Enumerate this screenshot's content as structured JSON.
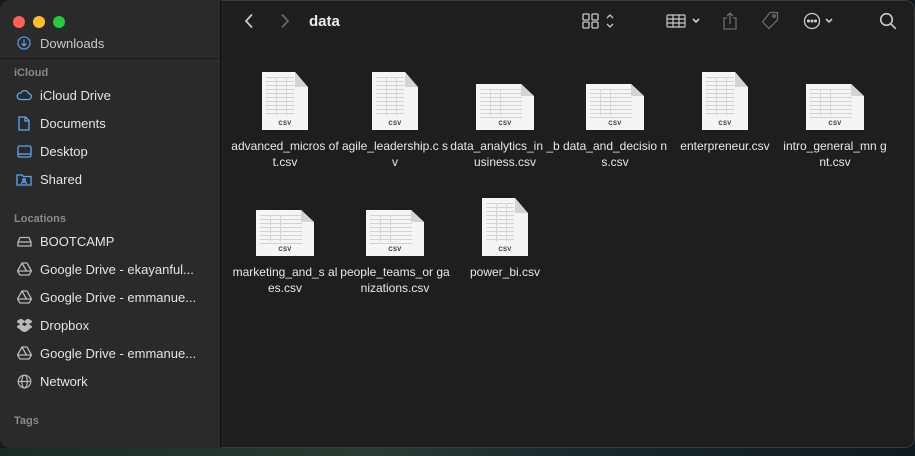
{
  "window": {
    "title": "data"
  },
  "sidebar": {
    "partial_item": "Downloads",
    "sections": [
      {
        "heading": "iCloud",
        "items": [
          {
            "label": "iCloud Drive",
            "icon": "cloud-icon"
          },
          {
            "label": "Documents",
            "icon": "document-icon"
          },
          {
            "label": "Desktop",
            "icon": "desktop-icon"
          },
          {
            "label": "Shared",
            "icon": "shared-folder-icon"
          }
        ]
      },
      {
        "heading": "Locations",
        "items": [
          {
            "label": "BOOTCAMP",
            "icon": "drive-icon"
          },
          {
            "label": "Google Drive - ekayanful...",
            "icon": "google-drive-icon"
          },
          {
            "label": "Google Drive - emmanue...",
            "icon": "google-drive-icon"
          },
          {
            "label": "Dropbox",
            "icon": "dropbox-icon"
          },
          {
            "label": "Google Drive - emmanue...",
            "icon": "google-drive-icon"
          },
          {
            "label": "Network",
            "icon": "globe-icon"
          }
        ]
      },
      {
        "heading": "Tags",
        "items": []
      }
    ]
  },
  "toolbar": {
    "back_icon": "chevron-left-icon",
    "forward_icon": "chevron-right-icon",
    "view_icon": "grid-view-icon",
    "group_icon": "group-icon",
    "share_icon": "share-icon",
    "tag_icon": "tag-icon",
    "more_icon": "ellipsis-icon",
    "search_icon": "search-icon"
  },
  "files": [
    {
      "name": "advanced_microsoft.csv",
      "display": "advanced_micros oft.csv",
      "shape": "tall",
      "badge": "CSV"
    },
    {
      "name": "agile_leadership.csv",
      "display": "agile_leadership.c sv",
      "shape": "tall",
      "badge": "CSV"
    },
    {
      "name": "data_analytics_in_business.csv",
      "display": "data_analytics_in _business.csv",
      "shape": "wide",
      "badge": "CSV"
    },
    {
      "name": "data_and_decisions.csv",
      "display": "data_and_decisio ns.csv",
      "shape": "wide",
      "badge": "CSV"
    },
    {
      "name": "enterpreneur.csv",
      "display": "enterpreneur.csv",
      "shape": "tall",
      "badge": "CSV"
    },
    {
      "name": "intro_general_mngnt.csv",
      "display": "intro_general_mn gnt.csv",
      "shape": "wide",
      "badge": "CSV"
    },
    {
      "name": "marketing_and_sales.csv",
      "display": "marketing_and_s ales.csv",
      "shape": "wide",
      "badge": "CSV"
    },
    {
      "name": "people_teams_organizations.csv",
      "display": "people_teams_or ganizations.csv",
      "shape": "wide",
      "badge": "CSV"
    },
    {
      "name": "power_bi.csv",
      "display": "power_bi.csv",
      "shape": "tall",
      "badge": "CSV"
    }
  ]
}
